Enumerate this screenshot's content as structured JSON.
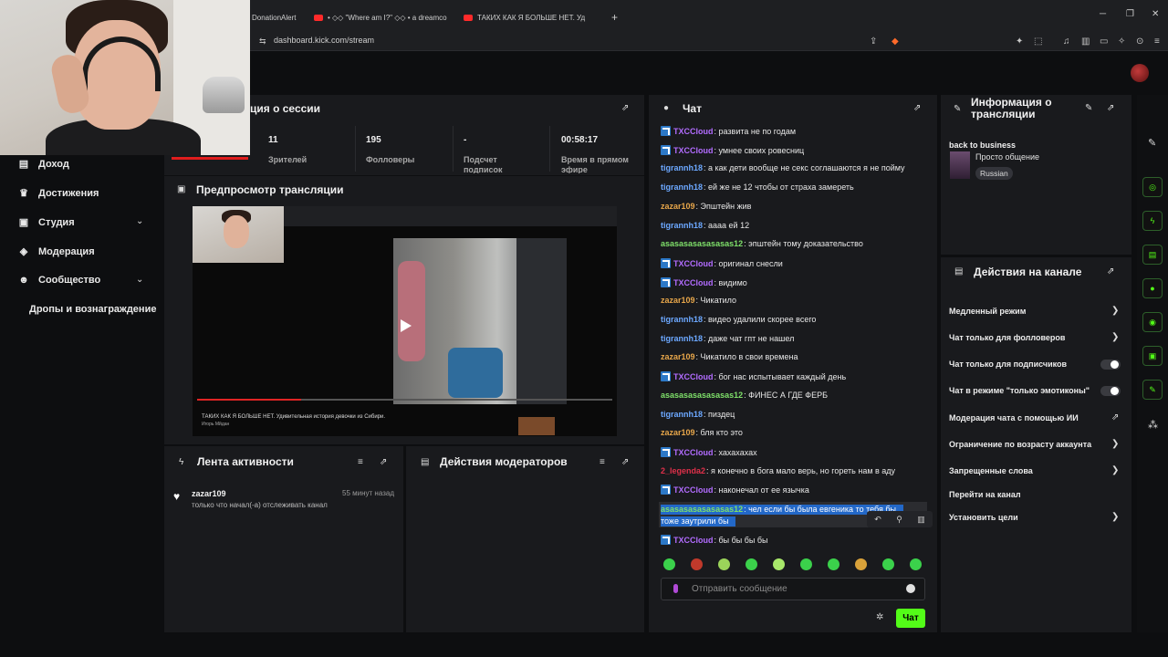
{
  "browser": {
    "tabs": [
      "DonationAlert",
      "• ◇◇ \"Where am I?\" ◇◇ • a dreamco",
      "ТАКИХ КАК Я БОЛЬШЕ НЕТ. Уд"
    ],
    "new_tab": "+",
    "url": "dashboard.kick.com/stream",
    "win_min": "─",
    "win_max": "❐",
    "win_close": "✕"
  },
  "sidebar": {
    "items": [
      {
        "label": "Доход",
        "icon": "income-icon"
      },
      {
        "label": "Достижения",
        "icon": "trophy-icon"
      },
      {
        "label": "Студия",
        "icon": "studio-icon"
      },
      {
        "label": "Модерация",
        "icon": "moderation-icon"
      },
      {
        "label": "Сообщество",
        "icon": "community-icon"
      }
    ],
    "sub_item": "Дропы и вознаграждение"
  },
  "session": {
    "title": "ция о сессии",
    "stats": [
      {
        "value": "11",
        "label": "Зрителей"
      },
      {
        "value": "195",
        "label": "Фолловеры"
      },
      {
        "value": "-",
        "label": "Подсчет подписок"
      },
      {
        "value": "00:58:17",
        "label": "Время в прямом эфире"
      }
    ]
  },
  "preview": {
    "title": "Предпросмотр трансляции",
    "video_title": "ТАКИХ КАК Я БОЛЬШЕ НЕТ. Удивительная история девочки из Сибири.",
    "video_channel": "Игорь Мйдан",
    "progress": 0.25
  },
  "activity": {
    "title": "Лента активности",
    "user": "zazar109",
    "time": "55 минут назад",
    "message": "только что начал(-а) отслеживать канал"
  },
  "mod_actions": {
    "title": "Действия модераторов"
  },
  "chat": {
    "title": "Чат",
    "messages": [
      {
        "user": "TXCCloud",
        "color": "#b26cff",
        "badge": true,
        "text": ": развита не по годам"
      },
      {
        "user": "TXCCloud",
        "color": "#b26cff",
        "badge": true,
        "text": ": умнее своих ровесниц"
      },
      {
        "user": "tigrannh18",
        "color": "#6ca8ff",
        "badge": false,
        "text": ": а как дети вообще не секс соглашаются я не пойму"
      },
      {
        "user": "tigrannh18",
        "color": "#6ca8ff",
        "badge": false,
        "text": ": ей же не 12 чтобы от страха замереть"
      },
      {
        "user": "zazar109",
        "color": "#e7a64a",
        "badge": false,
        "text": ": Эпштейн жив"
      },
      {
        "user": "tigrannh18",
        "color": "#6ca8ff",
        "badge": false,
        "text": ": аааа ей 12"
      },
      {
        "user": "asasasasasasasas12",
        "color": "#7fe06a",
        "badge": false,
        "text": ": эпштейн тому доказательство"
      },
      {
        "user": "TXCCloud",
        "color": "#b26cff",
        "badge": true,
        "text": ": оригинал снесли"
      },
      {
        "user": "TXCCloud",
        "color": "#b26cff",
        "badge": true,
        "text": ": видимо"
      },
      {
        "user": "zazar109",
        "color": "#e7a64a",
        "badge": false,
        "text": ": Чикатило"
      },
      {
        "user": "tigrannh18",
        "color": "#6ca8ff",
        "badge": false,
        "text": ": видео удалили скорее всего"
      },
      {
        "user": "tigrannh18",
        "color": "#6ca8ff",
        "badge": false,
        "text": ": даже чат гпт не нашел"
      },
      {
        "user": "zazar109",
        "color": "#e7a64a",
        "badge": false,
        "text": ": Чикатило в свои времена"
      },
      {
        "user": "TXCCloud",
        "color": "#b26cff",
        "badge": true,
        "text": ": бог нас испытывает каждый день"
      },
      {
        "user": "asasasasasasasas12",
        "color": "#7fe06a",
        "badge": false,
        "text": ": ФИНЕС А ГДЕ ФЕРБ"
      },
      {
        "user": "tigrannh18",
        "color": "#6ca8ff",
        "badge": false,
        "text": ": пиздец"
      },
      {
        "user": "zazar109",
        "color": "#e7a64a",
        "badge": false,
        "text": ": бля кто это"
      },
      {
        "user": "TXCCloud",
        "color": "#b26cff",
        "badge": true,
        "text": ": хахахахах"
      },
      {
        "user": "2_legenda2",
        "color": "#e0304a",
        "badge": false,
        "text": ": я конечно в бога мало верь, но гореть нам в аду"
      },
      {
        "user": "TXCCloud",
        "color": "#b26cff",
        "badge": true,
        "text": ": наконечал от ее язычка"
      }
    ],
    "highlighted": {
      "user": "asasasasasasasas12",
      "line1": ": чел если бы была евгеника то тебя бы",
      "line2": "тоже заутрили бы"
    },
    "last": {
      "user": "TXCCloud",
      "color": "#b26cff",
      "text": ": бы бы бы бы"
    },
    "input_placeholder": "Отправить сообщение",
    "send_label": "Чат"
  },
  "stream_info": {
    "title": "Информация о трансляции",
    "stream_title": "back to business",
    "category": "Просто общение",
    "tag": "Russian"
  },
  "channel_actions": {
    "title": "Действия на канале",
    "rows": [
      {
        "label": "Медленный режим",
        "kind": "chevron"
      },
      {
        "label": "Чат только для фолловеров",
        "kind": "chevron"
      },
      {
        "label": "Чат только для подписчиков",
        "kind": "toggle"
      },
      {
        "label": "Чат в режиме \"только эмотиконы\"",
        "kind": "toggle"
      },
      {
        "label": "Модерация чата с помощью ИИ",
        "kind": "external"
      },
      {
        "label": "Ограничение по возрасту аккаунта",
        "kind": "chevron"
      },
      {
        "label": "Запрещенные слова",
        "kind": "chevron"
      },
      {
        "label": "Перейти на канал",
        "kind": "none"
      },
      {
        "label": "Установить цели",
        "kind": "chevron"
      }
    ]
  },
  "colors": {
    "accent": "#53fc18",
    "panel": "#191a1d",
    "bg": "#0d0e10"
  }
}
